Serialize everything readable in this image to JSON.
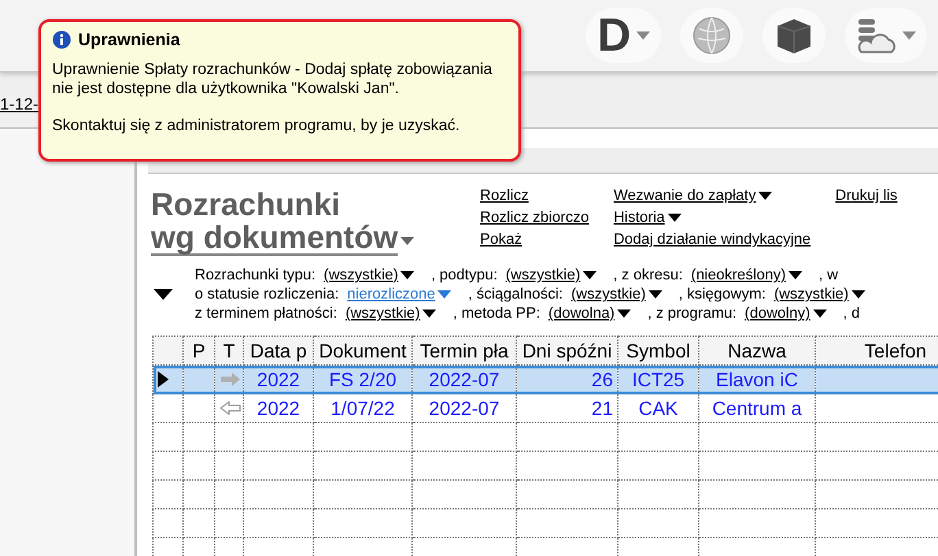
{
  "toolbar": {
    "logo_letter": "D"
  },
  "left_panel": {
    "date_link": "1-12-"
  },
  "tooltip": {
    "title": "Uprawnienia",
    "paragraphs": [
      "Uprawnienie Spłaty rozrachunków - Dodaj spłatę zobowiązania nie jest dostępne dla użytkownika \"Kowalski Jan\".",
      "Skontaktuj się z administratorem programu, by je uzyskać."
    ]
  },
  "view": {
    "title_lines": [
      "Rozrachunki",
      "wg dokumentów"
    ],
    "link_columns": [
      [
        {
          "label": "Rozlicz",
          "dropdown": false
        },
        {
          "label": "Rozlicz zbiorczo",
          "dropdown": false
        },
        {
          "label": "Pokaż",
          "dropdown": false
        }
      ],
      [
        {
          "label": "Wezwanie do zapłaty",
          "dropdown": true
        },
        {
          "label": "Historia",
          "dropdown": true
        },
        {
          "label": "Dodaj działanie windykacyjne",
          "dropdown": false
        }
      ],
      [
        {
          "label": "Drukuj lis",
          "dropdown": false
        }
      ]
    ]
  },
  "filters": [
    [
      {
        "kind": "label",
        "text": "Rozrachunki typu:"
      },
      {
        "kind": "dropdown",
        "text": "(wszystkie)",
        "active": false
      },
      {
        "kind": "label",
        "text": ", podtypu:"
      },
      {
        "kind": "dropdown",
        "text": "(wszystkie)",
        "active": false
      },
      {
        "kind": "label",
        "text": ", z okresu:"
      },
      {
        "kind": "dropdown",
        "text": "(nieokreślony)",
        "active": false
      },
      {
        "kind": "label",
        "text": ", w"
      }
    ],
    [
      {
        "kind": "label",
        "text": "o statusie rozliczenia:"
      },
      {
        "kind": "dropdown",
        "text": "nierozliczone",
        "active": true
      },
      {
        "kind": "label",
        "text": ", ściągalności:"
      },
      {
        "kind": "dropdown",
        "text": "(wszystkie)",
        "active": false
      },
      {
        "kind": "label",
        "text": ", księgowym:"
      },
      {
        "kind": "dropdown",
        "text": "(wszystkie)",
        "active": false
      }
    ],
    [
      {
        "kind": "label",
        "text": "z terminem płatności:"
      },
      {
        "kind": "dropdown",
        "text": "(wszystkie)",
        "active": false
      },
      {
        "kind": "label",
        "text": ", metoda PP:"
      },
      {
        "kind": "dropdown",
        "text": "(dowolna)",
        "active": false
      },
      {
        "kind": "label",
        "text": ", z programu:"
      },
      {
        "kind": "dropdown",
        "text": "(dowolny)",
        "active": false
      },
      {
        "kind": "label",
        "text": ", d"
      }
    ]
  ],
  "table": {
    "columns": [
      "",
      "P",
      "T",
      "Data p",
      "Dokument",
      "Termin pła",
      "Dni spóźni",
      "Symbol",
      "Nazwa",
      "Telefon"
    ],
    "rows": [
      {
        "selected": true,
        "kind": "outgoing",
        "cells": [
          "",
          "",
          "",
          "2022",
          "FS 2/20",
          "2022-07",
          "26",
          "ICT25",
          "Elavon iC",
          ""
        ]
      },
      {
        "selected": false,
        "kind": "incoming",
        "cells": [
          "",
          "",
          "",
          "2022",
          "1/07/22",
          "2022-07",
          "21",
          "CAK",
          "Centrum a",
          ""
        ]
      }
    ]
  }
}
